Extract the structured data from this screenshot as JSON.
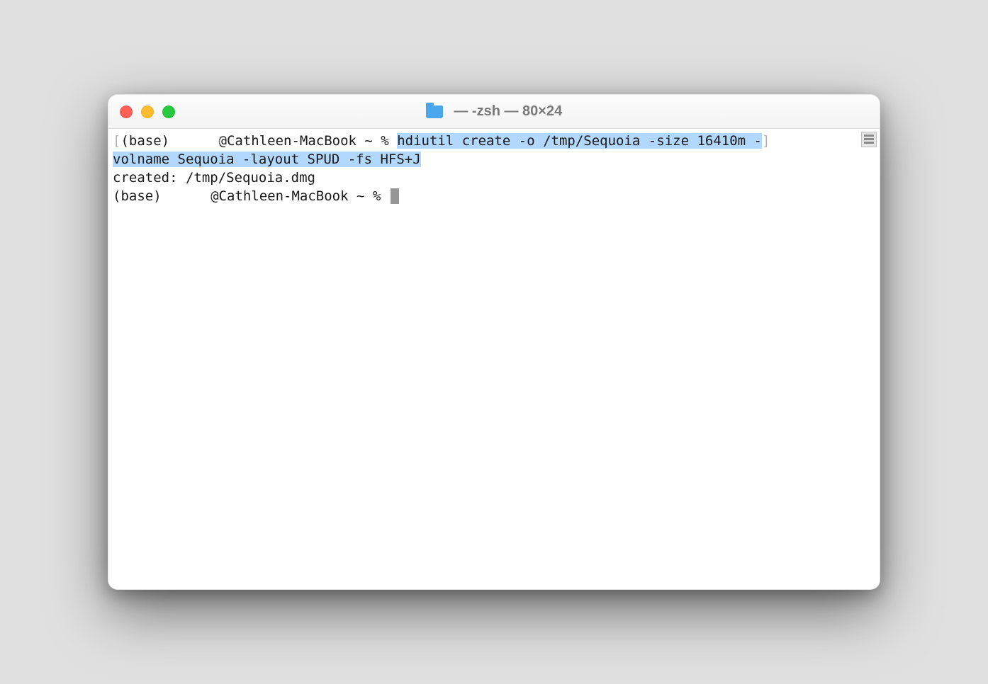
{
  "window": {
    "title": " — -zsh — 80×24"
  },
  "terminal": {
    "line1": {
      "open_bracket": "[",
      "prompt_prefix": "(base) ",
      "user_redacted_width": 58,
      "prompt_suffix": "@Cathleen-MacBook ~ % ",
      "cmd_part_a": "hdiutil create -o /tmp/Sequoia -size 16410m -",
      "close_bracket": "]"
    },
    "line2_selected": "volname Sequoia -layout SPUD -fs HFS+J",
    "line3": "created: /tmp/Sequoia.dmg",
    "line4": {
      "prompt_prefix": "(base) ",
      "user_redacted_width": 58,
      "prompt_suffix": "@Cathleen-MacBook ~ % "
    }
  }
}
